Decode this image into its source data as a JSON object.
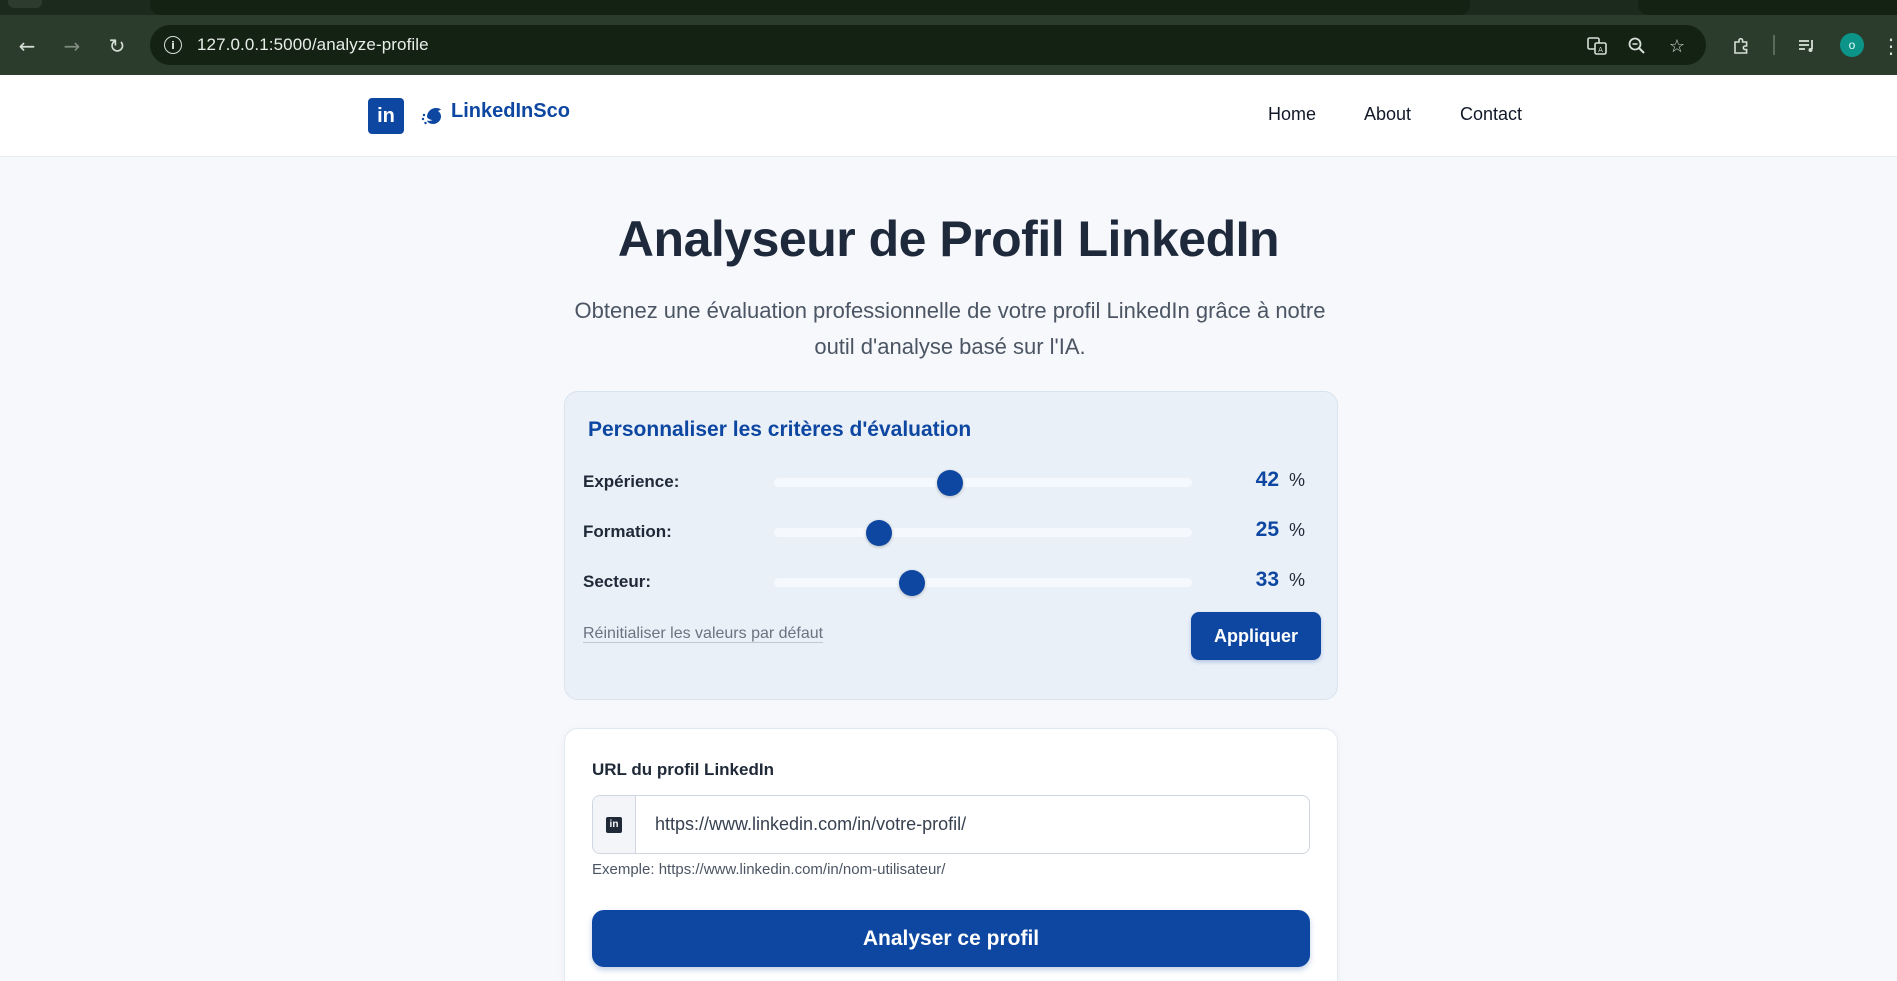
{
  "browser": {
    "url": "127.0.0.1:5000/analyze-profile",
    "profile_initial": "o",
    "icons": {
      "back": "arrow-left-icon",
      "forward": "arrow-right-icon",
      "reload": "reload-icon",
      "site_info": "info-icon",
      "translate": "translate-icon",
      "zoom": "zoom-out-icon",
      "bookmark": "star-icon",
      "extensions": "puzzle-icon",
      "media": "media-queue-icon",
      "menu": "kebab-menu-icon"
    }
  },
  "header": {
    "logo_mark": "in",
    "brand": "LinkedInSco",
    "nav": [
      {
        "label": "Home"
      },
      {
        "label": "About"
      },
      {
        "label": "Contact"
      }
    ]
  },
  "hero": {
    "title": "Analyseur de Profil LinkedIn",
    "subtitle": "Obtenez une évaluation professionnelle de votre profil LinkedIn grâce à notre outil d'analyse basé sur l'IA."
  },
  "criteria": {
    "title": "Personnaliser les critères d'évaluation",
    "items": [
      {
        "label": "Expérience:",
        "value": "42",
        "unit": "%",
        "fraction": 0.42
      },
      {
        "label": "Formation:",
        "value": "25",
        "unit": "%",
        "fraction": 0.25
      },
      {
        "label": "Secteur:",
        "value": "33",
        "unit": "%",
        "fraction": 0.33
      }
    ],
    "reset_label": "Réinitialiser les valeurs par défaut",
    "apply_label": "Appliquer"
  },
  "analyze": {
    "url_label": "URL du profil LinkedIn",
    "addon_icon": "linkedin-icon",
    "placeholder": "https://www.linkedin.com/in/votre-profil/",
    "hint": "Exemple: https://www.linkedin.com/in/nom-utilisateur/",
    "button_label": "Analyser ce profil"
  },
  "colors": {
    "brand": "#0d47a1",
    "page_bg": "#f6f8fb",
    "card_bg": "#eaf0f8",
    "chrome_bg": "#2b3b2c"
  }
}
